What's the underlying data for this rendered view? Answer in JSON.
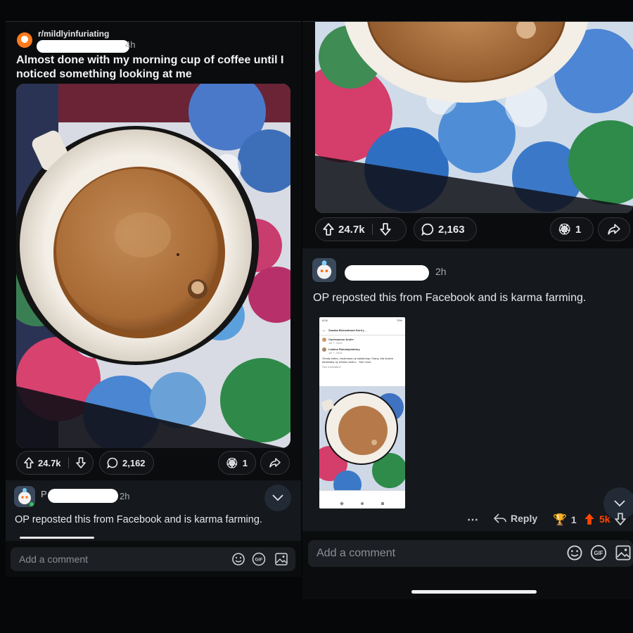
{
  "left": {
    "subreddit": "r/mildlyinfuriating",
    "time": "4h",
    "title_line1": "Almost done with my morning cup of coffee until I",
    "title_line2": "noticed something looking at me",
    "upvotes": "24.7k",
    "comments": "2,162",
    "awards": "1",
    "comment": {
      "time": "2h",
      "text": "OP reposted this from Facebook and is karma farming.",
      "author_initial": "P"
    },
    "add_comment_placeholder": "Add a comment"
  },
  "right": {
    "upvotes": "24.7k",
    "comments": "2,163",
    "awards": "1",
    "comment": {
      "time": "2h",
      "text": "OP reposted this from Facebook and is karma farming.",
      "reply_label": "Reply",
      "award_count": "1",
      "vote_score": "5k"
    },
    "fb_screenshot": {
      "status_time": "6:04",
      "status_batt": "70%",
      "page_name": "Zanaka Belowdrana Nord j...",
      "commenter1": "Carrisauson Andre",
      "commenter1_date": "Jul 7, 2024",
      "commenter2": "Lalaina Ramanjanahary",
      "commenter2_date": "Jul 7, 2024",
      "comment2_text": "Omaly kafea, nisotroana ny sakafonay i Nany, afa nizaha tantanaky ny lovtoko andro...  See more",
      "see_translation": "See translation"
    },
    "add_comment_placeholder": "Add a comment"
  },
  "colors": {
    "upvote_orange": "#ff4500",
    "background": "#0b0c0e",
    "pill_border": "#33363a"
  }
}
